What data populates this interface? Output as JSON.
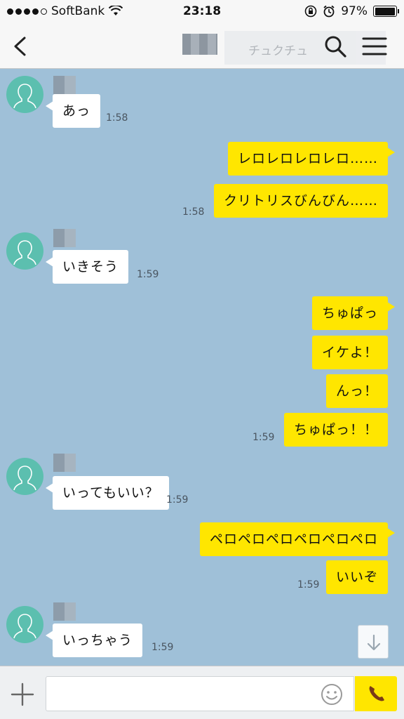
{
  "status_bar": {
    "carrier": "SoftBank",
    "time": "23:18",
    "battery": "97%",
    "battery_level": 0.97
  },
  "header": {
    "contact_subtitle": "チュクチュ"
  },
  "messages": [
    {
      "side": "in",
      "text": "あっ",
      "time": "1:58"
    },
    {
      "side": "out",
      "text": "レロレロレロレロ……"
    },
    {
      "side": "out",
      "text": "クリトリスびんびん……",
      "time": "1:58"
    },
    {
      "side": "in",
      "text": "いきそう",
      "time": "1:59"
    },
    {
      "side": "out",
      "text": "ちゅぱっ"
    },
    {
      "side": "out",
      "text": "イケよ！"
    },
    {
      "side": "out",
      "text": "んっ！"
    },
    {
      "side": "out",
      "text": "ちゅぱっ！！",
      "time": "1:59"
    },
    {
      "side": "in",
      "text": "いってもいい？",
      "time": "1:59"
    },
    {
      "side": "out",
      "text": "ペロペロペロペロペロペロ"
    },
    {
      "side": "out",
      "text": "いいぞ",
      "time": "1:59"
    },
    {
      "side": "in",
      "text": "いっちゃう",
      "time": "1:59"
    }
  ],
  "input": {
    "value": "",
    "placeholder": ""
  },
  "icons": {
    "back": "chevron-left-icon",
    "search": "search-icon",
    "menu": "menu-icon",
    "plus": "plus-icon",
    "emoji": "smiley-icon",
    "call": "phone-icon",
    "scroll_down": "arrow-down-icon"
  },
  "colors": {
    "chat_background": "#9fc0d8",
    "outgoing_bubble": "#ffe600",
    "incoming_bubble": "#ffffff",
    "avatar": "#5cbfaf"
  }
}
